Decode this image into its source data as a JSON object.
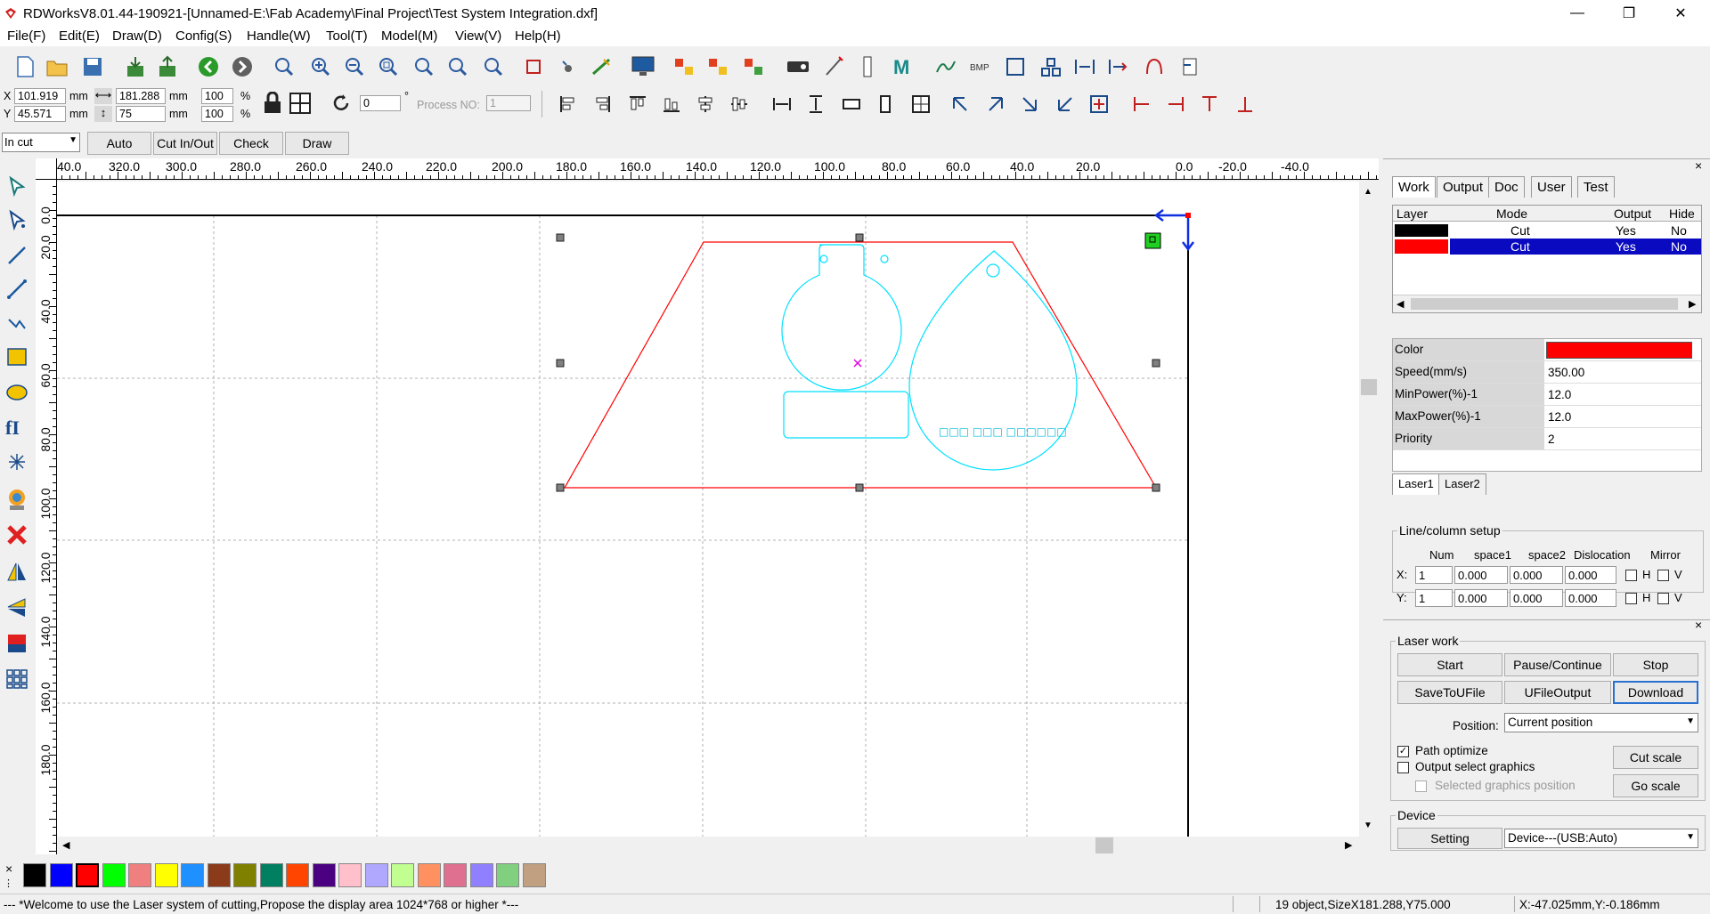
{
  "window": {
    "title": "RDWorksV8.01.44-190921-[Unnamed-E:\\Fab Academy\\Final Project\\Test System Integration.dxf]",
    "minimize": "—",
    "maximize": "❐",
    "close": "✕"
  },
  "menu": [
    "File(F)",
    "Edit(E)",
    "Draw(D)",
    "Config(S)",
    "Handle(W)",
    "Tool(T)",
    "Model(M)",
    "View(V)",
    "Help(H)"
  ],
  "position": {
    "x_label": "X",
    "x_value": "101.919",
    "y_label": "Y",
    "y_value": "45.571",
    "unit": "mm",
    "width_value": "181.288",
    "height_value": "75",
    "width_pct": "100",
    "height_pct": "100",
    "pct": "%",
    "rotate_value": "0",
    "degree": "°",
    "process_label": "Process NO:",
    "process_value": "1"
  },
  "cut_toolbar": {
    "mode": "In cut",
    "buttons": [
      "Auto",
      "Cut In/Out",
      "Check",
      "Draw"
    ]
  },
  "ruler": {
    "h_labels": [
      "40.0",
      "320.0",
      "300.0",
      "280.0",
      "260.0",
      "240.0",
      "220.0",
      "200.0",
      "180.0",
      "160.0",
      "140.0",
      "120.0",
      "100.0",
      "80.0",
      "60.0",
      "40.0",
      "20.0",
      "0.0",
      "-20.0",
      "-40.0"
    ],
    "v_labels": [
      "0.0",
      "20.0",
      "40.0",
      "60.0",
      "80.0",
      "100.0",
      "120.0",
      "140.0",
      "160.0",
      "180.0"
    ]
  },
  "canvas": {
    "text_glyphs": "□□□ □□□ □□□□□□"
  },
  "palette": {
    "close": "×",
    "colors": [
      "#000000",
      "#0000ff",
      "#ff0000",
      "#00ff00",
      "#f08080",
      "#ffff00",
      "#1e90ff",
      "#8b3a1a",
      "#808000",
      "#008060",
      "#ff4500",
      "#4b0082",
      "#ffc0cb",
      "#b0a8ff",
      "#c0ff90",
      "#ff9060",
      "#e07090",
      "#9080ff",
      "#80d080",
      "#c0a080"
    ]
  },
  "statusbar": {
    "message": "--- *Welcome to use the Laser system of cutting,Propose the display area 1024*768 or higher *---",
    "objects": "19 object,SizeX181.288,Y75.000",
    "coords": "X:-47.025mm,Y:-0.186mm"
  },
  "panel": {
    "close": "×",
    "tabs": [
      "Work",
      "Output",
      "Doc",
      "User",
      "Test"
    ],
    "layer_headers": [
      "Layer",
      "Mode",
      "Output",
      "Hide"
    ],
    "layers": [
      {
        "color": "#000000",
        "mode": "Cut",
        "output": "Yes",
        "hide": "No"
      },
      {
        "color": "#ff0000",
        "mode": "Cut",
        "output": "Yes",
        "hide": "No"
      }
    ],
    "props": [
      {
        "label": "Color",
        "value": ""
      },
      {
        "label": "Speed(mm/s)",
        "value": "350.00"
      },
      {
        "label": "MinPower(%)-1",
        "value": "12.0"
      },
      {
        "label": "MaxPower(%)-1",
        "value": "12.0"
      },
      {
        "label": "Priority",
        "value": "2"
      }
    ],
    "prop_color": "#ff0000",
    "laser_tabs": [
      "Laser1",
      "Laser2"
    ],
    "linecol": {
      "title": "Line/column setup",
      "headers": [
        "Num",
        "space1",
        "space2",
        "Dislocation",
        "Mirror"
      ],
      "rows": [
        {
          "axis": "X:",
          "num": "1",
          "space1": "0.000",
          "space2": "0.000",
          "dislocation": "0.000",
          "h": "H",
          "v": "V"
        },
        {
          "axis": "Y:",
          "num": "1",
          "space1": "0.000",
          "space2": "0.000",
          "dislocation": "0.000",
          "h": "H",
          "v": "V"
        }
      ]
    }
  },
  "laserwork": {
    "close": "×",
    "title": "Laser work",
    "buttons_row1": [
      "Start",
      "Pause/Continue",
      "Stop"
    ],
    "buttons_row2": [
      "SaveToUFile",
      "UFileOutput",
      "Download"
    ],
    "position_label": "Position:",
    "position_value": "Current position",
    "path_optimize": "Path optimize",
    "output_select": "Output select graphics",
    "selected_position": "Selected graphics position",
    "cut_scale": "Cut scale",
    "go_scale": "Go scale",
    "device_title": "Device",
    "setting": "Setting",
    "device_value": "Device---(USB:Auto)"
  }
}
